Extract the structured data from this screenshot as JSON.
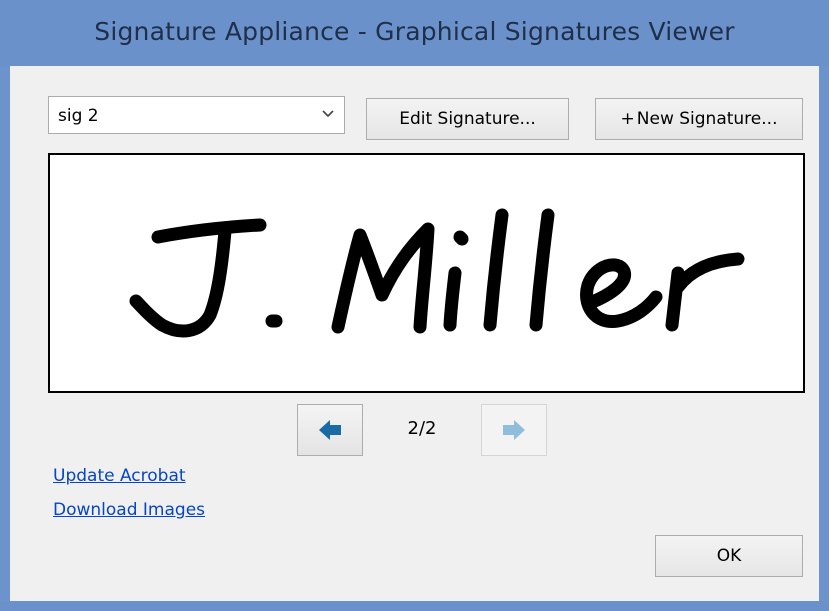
{
  "window": {
    "title": "Signature Appliance - Graphical Signatures Viewer"
  },
  "toolbar": {
    "signature_select_value": "sig 2",
    "edit_label": "Edit Signature...",
    "new_plus": "+",
    "new_label": "New Signature..."
  },
  "signature": {
    "text": "J. Miller"
  },
  "pager": {
    "counter": "2/2"
  },
  "links": {
    "update_acrobat": "Update Acrobat",
    "download_images": "Download Images"
  },
  "footer": {
    "ok_label": "OK"
  },
  "colors": {
    "titlebar": "#6b91cb",
    "arrow_active": "#1a6aa6",
    "arrow_disabled": "#8fbedb",
    "link": "#0645c8"
  },
  "icons": {
    "select_arrow": "chevron-down-icon",
    "prev": "arrow-left-icon",
    "next": "arrow-right-icon"
  }
}
